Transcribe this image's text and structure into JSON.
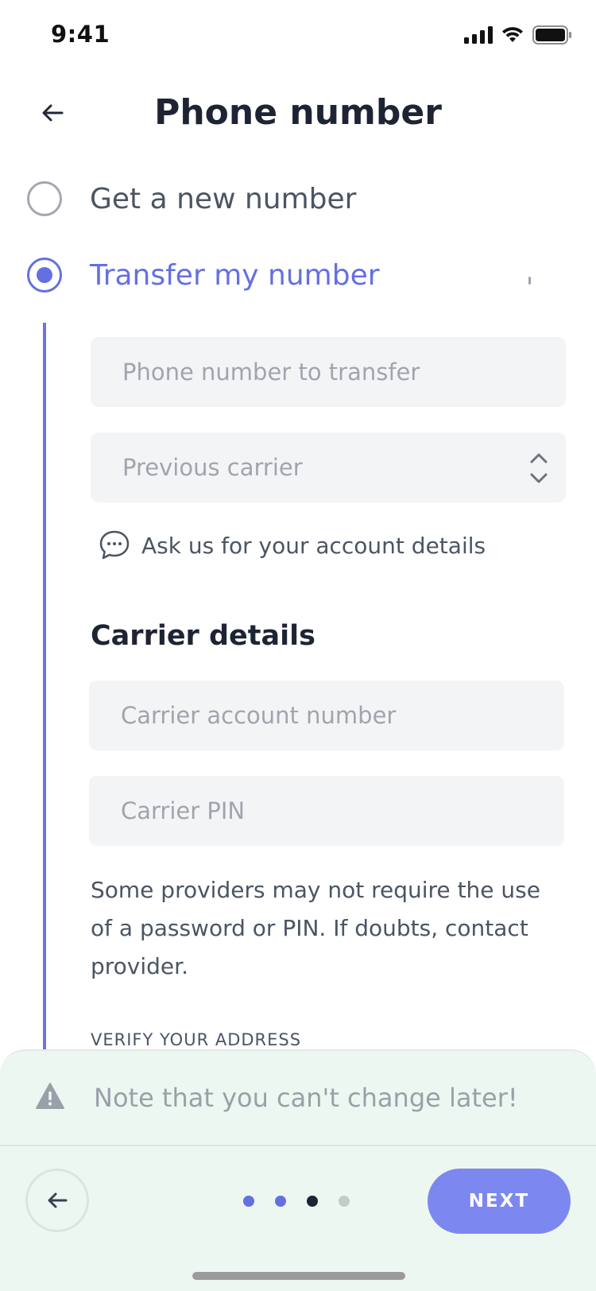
{
  "status_bar": {
    "time": "9:41"
  },
  "header": {
    "title": "Phone number"
  },
  "options": [
    {
      "label": "Get a new number",
      "selected": false
    },
    {
      "label": "Transfer my number",
      "selected": true
    }
  ],
  "transfer_form": {
    "phone_placeholder": "Phone number to transfer",
    "carrier_placeholder": "Previous carrier",
    "ask_link": "Ask us for your account details"
  },
  "carrier_details": {
    "title": "Carrier details",
    "account_placeholder": "Carrier account number",
    "pin_placeholder": "Carrier PIN",
    "helper": "Some providers may not require the use of a password or PIN. If doubts, contact provider."
  },
  "verify": {
    "title": "VERIFY YOUR ADDRESS"
  },
  "bottom_sheet": {
    "note": "Note that you can't change later!",
    "next_label": "NEXT",
    "steps_total": 4,
    "current_step": 3
  },
  "colors": {
    "accent": "#6470e0",
    "next_button": "#7c88ef",
    "sheet_bg": "#edf7f1",
    "dot_done": "#6470e0",
    "dot_current": "#1e2433",
    "dot_pending": "#c5cbc7"
  }
}
